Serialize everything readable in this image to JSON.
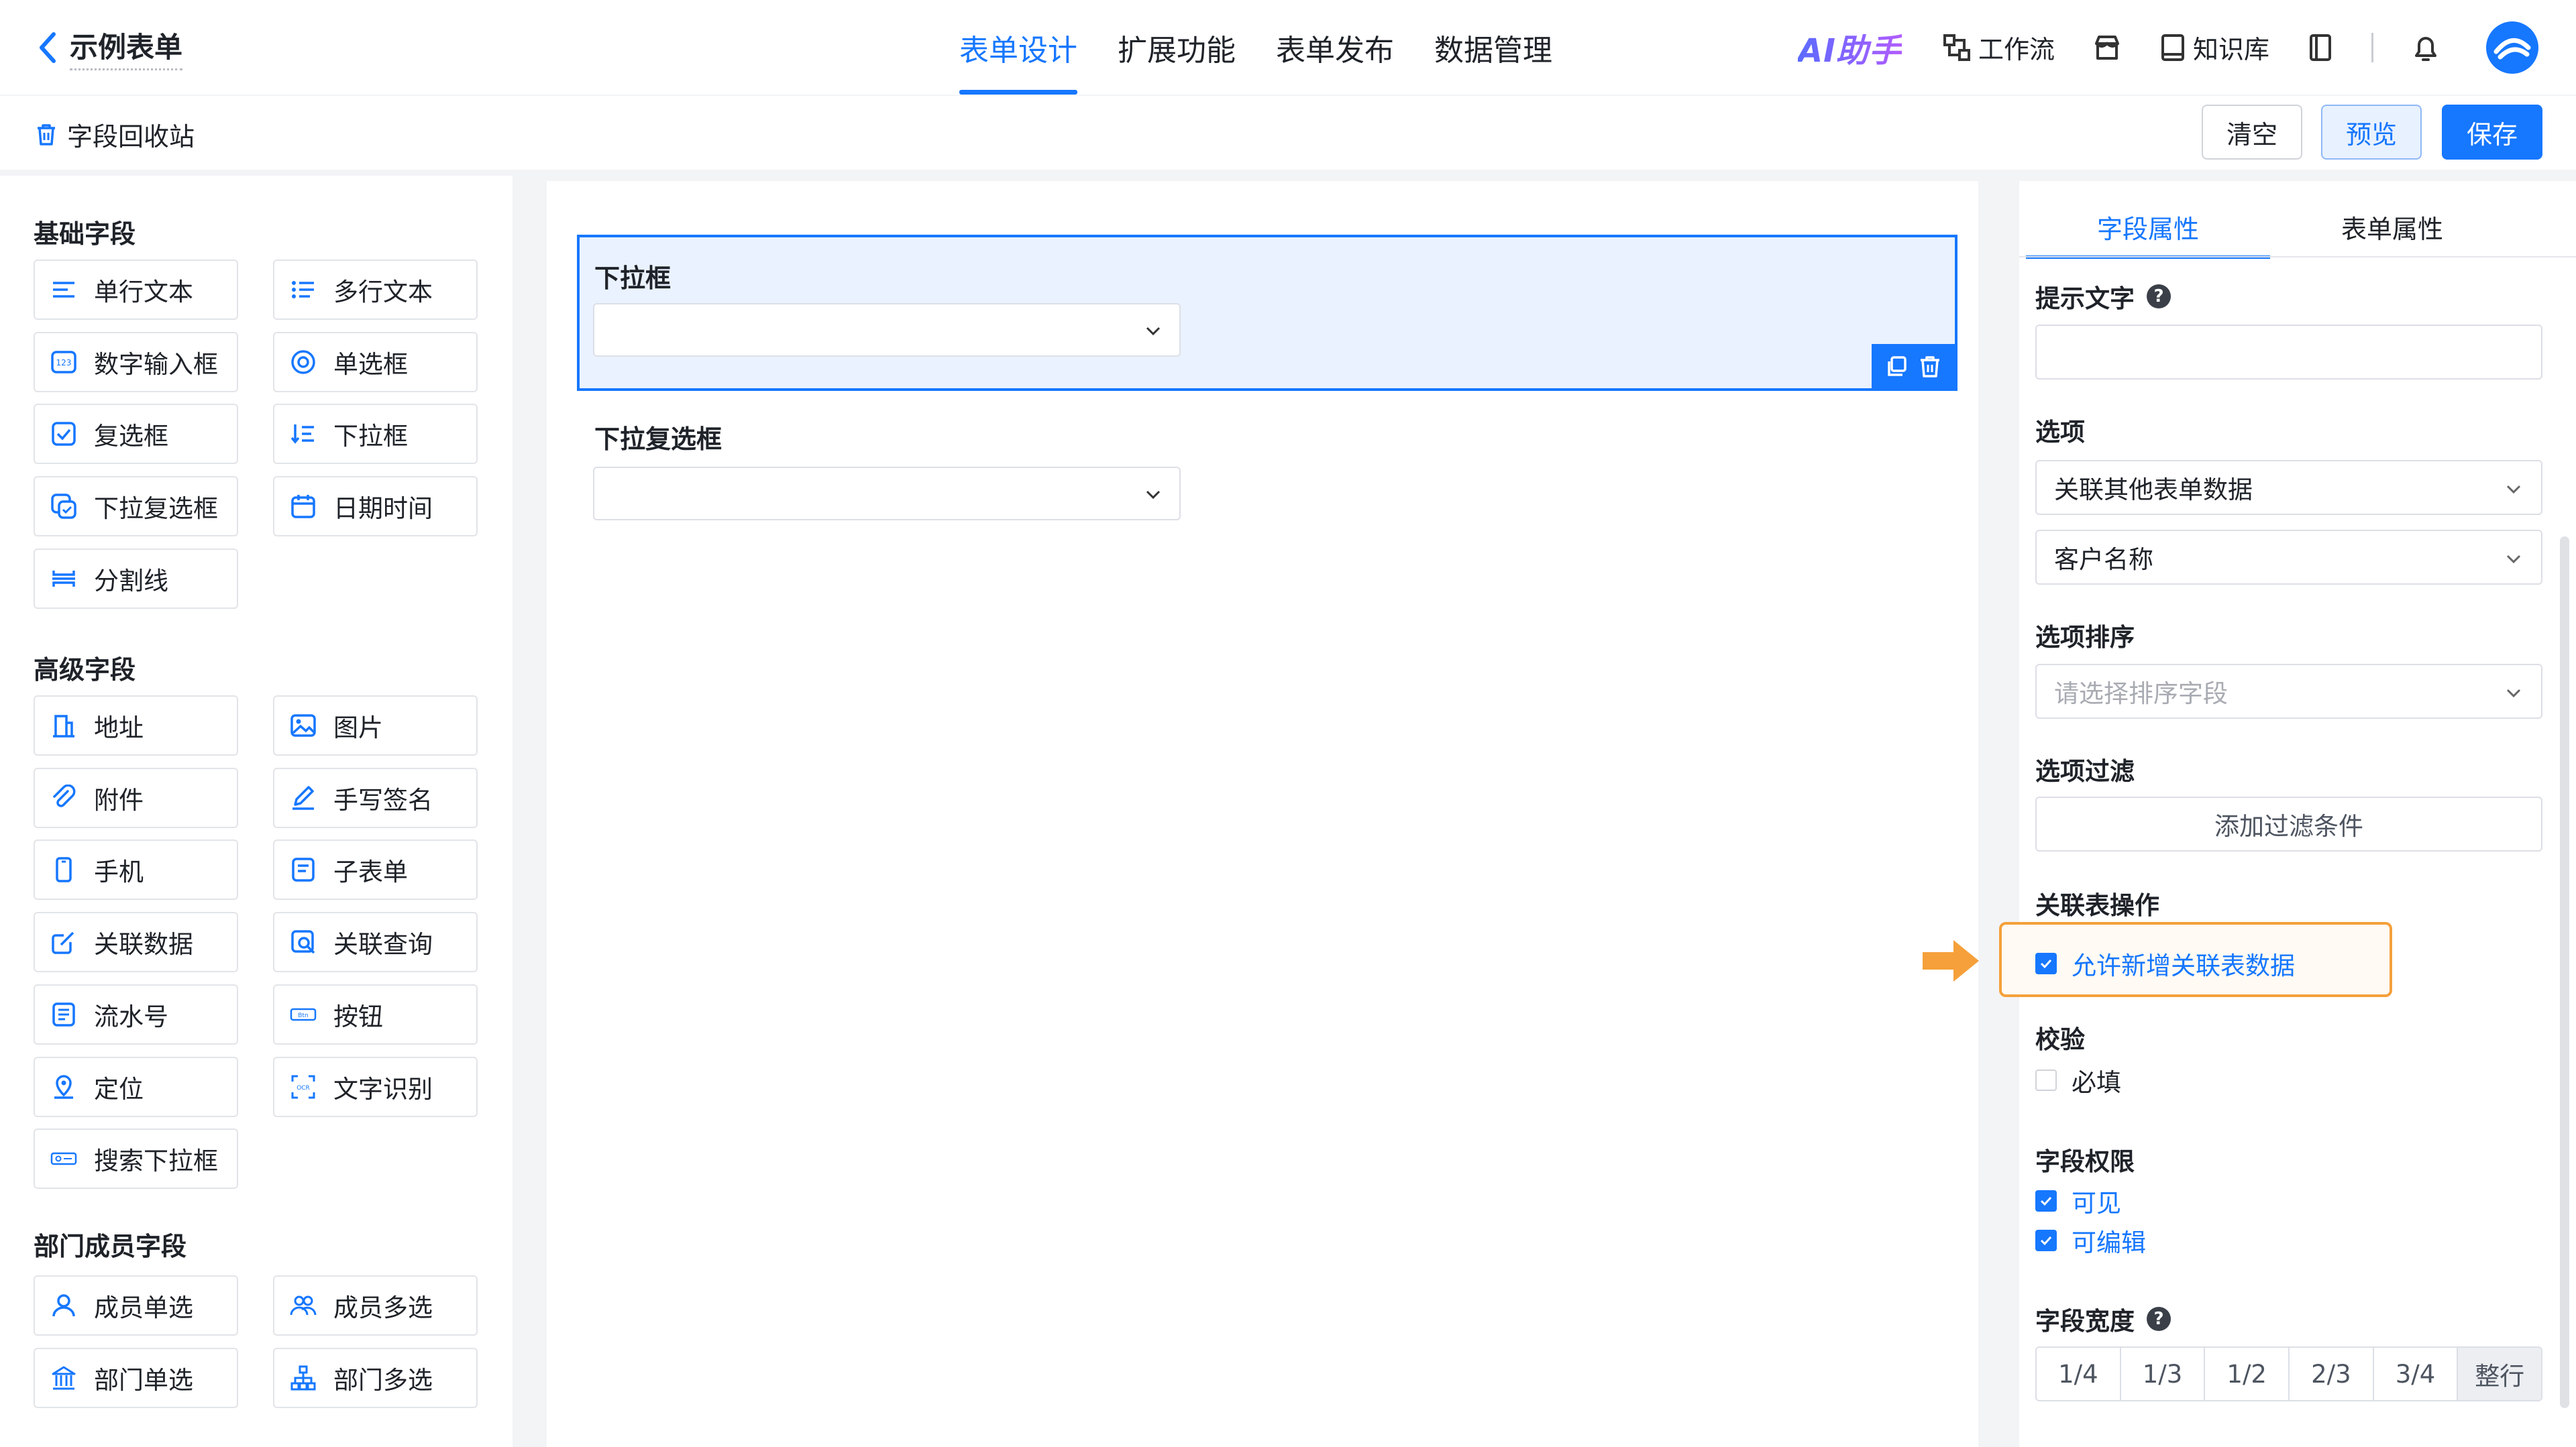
{
  "header": {
    "back_title": "示例表单",
    "tabs": [
      {
        "label": "表单设计",
        "active": true
      },
      {
        "label": "扩展功能",
        "active": false
      },
      {
        "label": "表单发布",
        "active": false
      },
      {
        "label": "数据管理",
        "active": false
      }
    ],
    "ai_label": "AI助手",
    "workflow_label": "工作流",
    "knowledge_label": "知识库"
  },
  "toolbar": {
    "recycle_label": "字段回收站",
    "clear_label": "清空",
    "preview_label": "预览",
    "save_label": "保存"
  },
  "palette": {
    "basic_title": "基础字段",
    "basic": [
      "单行文本",
      "多行文本",
      "数字输入框",
      "单选框",
      "复选框",
      "下拉框",
      "下拉复选框",
      "日期时间",
      "分割线"
    ],
    "advanced_title": "高级字段",
    "advanced": [
      "地址",
      "图片",
      "附件",
      "手写签名",
      "手机",
      "子表单",
      "关联数据",
      "关联查询",
      "流水号",
      "按钮",
      "定位",
      "文字识别",
      "搜索下拉框"
    ],
    "member_title": "部门成员字段",
    "member": [
      "成员单选",
      "成员多选",
      "部门单选",
      "部门多选"
    ]
  },
  "canvas": {
    "field1_label": "下拉框",
    "field2_label": "下拉复选框"
  },
  "props": {
    "tab_field": "字段属性",
    "tab_form": "表单属性",
    "hint_label": "提示文字",
    "hint_value": "",
    "options_label": "选项",
    "options_source": "关联其他表单数据",
    "options_field": "客户名称",
    "sort_label": "选项排序",
    "sort_placeholder": "请选择排序字段",
    "filter_label": "选项过滤",
    "filter_button": "添加过滤条件",
    "relation_label": "关联表操作",
    "relation_allow_add": "允许新增关联表数据",
    "validate_label": "校验",
    "required_label": "必填",
    "perm_label": "字段权限",
    "perm_visible": "可见",
    "perm_editable": "可编辑",
    "width_label": "字段宽度",
    "widths": [
      "1/4",
      "1/3",
      "1/2",
      "2/3",
      "3/4",
      "整行"
    ]
  },
  "colors": {
    "accent": "#1677ff",
    "highlight": "#f5a03a"
  }
}
